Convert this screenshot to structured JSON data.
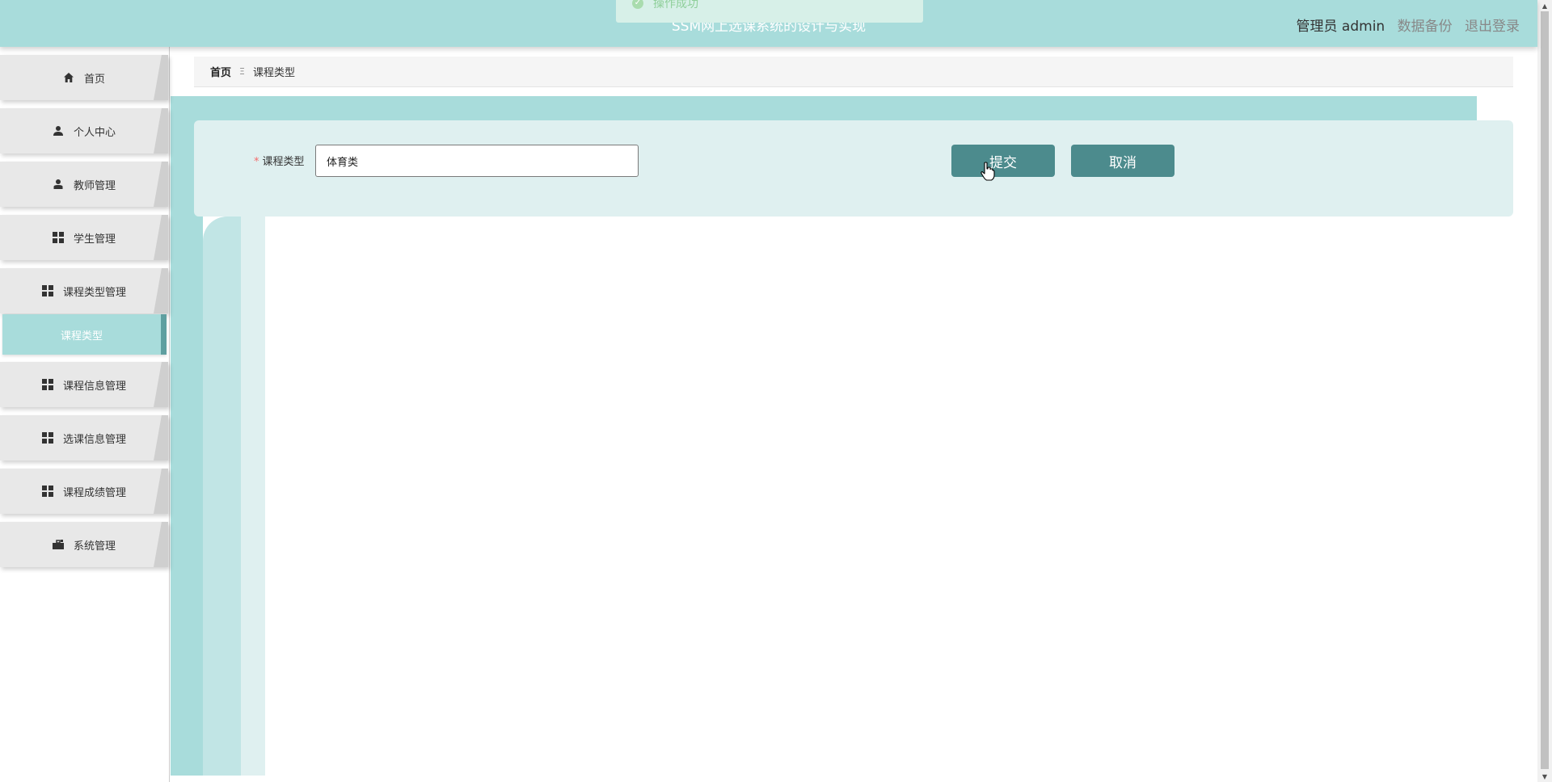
{
  "header": {
    "title": "SSM网上选课系统的设计与实现",
    "user_label": "管理员 admin",
    "backup_label": "数据备份",
    "logout_label": "退出登录"
  },
  "toast": {
    "message": "操作成功",
    "icon": "check-circle-icon"
  },
  "sidebar": {
    "items": [
      {
        "label": "首页",
        "icon": "home-icon"
      },
      {
        "label": "个人中心",
        "icon": "user-icon"
      },
      {
        "label": "教师管理",
        "icon": "user-icon"
      },
      {
        "label": "学生管理",
        "icon": "grid-icon"
      },
      {
        "label": "课程类型管理",
        "icon": "grid-icon"
      },
      {
        "label": "课程信息管理",
        "icon": "grid-icon"
      },
      {
        "label": "选课信息管理",
        "icon": "grid-icon"
      },
      {
        "label": "课程成绩管理",
        "icon": "grid-icon"
      },
      {
        "label": "系统管理",
        "icon": "briefcase-icon"
      }
    ],
    "active_submenu": "课程类型"
  },
  "breadcrumb": {
    "home": "首页",
    "separator": "Ξ",
    "current": "课程类型"
  },
  "form": {
    "required_mark": "*",
    "field_label": "课程类型",
    "field_value": "体育类",
    "submit_label": "提交",
    "cancel_label": "取消"
  },
  "colors": {
    "header_bg": "#a8dcdb",
    "button_bg": "#4c8b8d",
    "panel_bg": "#dff0f0",
    "active_submenu_bg": "#a8dcdb",
    "required": "#f56c6c"
  }
}
